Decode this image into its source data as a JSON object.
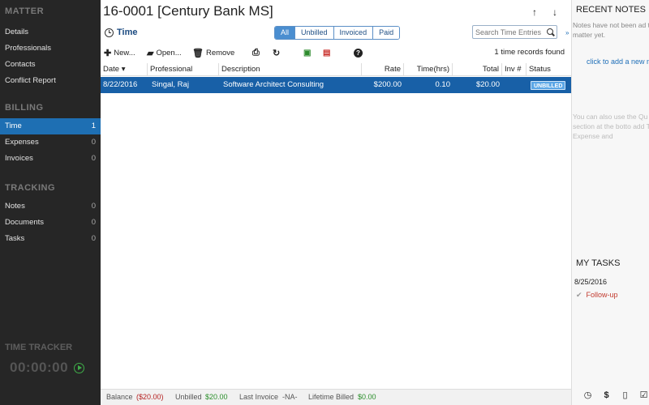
{
  "sidebar": {
    "sections": [
      {
        "title": "MATTER",
        "items": [
          {
            "label": "Details",
            "count": ""
          },
          {
            "label": "Professionals",
            "count": ""
          },
          {
            "label": "Contacts",
            "count": ""
          },
          {
            "label": "Conflict Report",
            "count": ""
          }
        ]
      },
      {
        "title": "BILLING",
        "items": [
          {
            "label": "Time",
            "count": "1"
          },
          {
            "label": "Expenses",
            "count": "0"
          },
          {
            "label": "Invoices",
            "count": "0"
          }
        ]
      },
      {
        "title": "TRACKING",
        "items": [
          {
            "label": "Notes",
            "count": "0"
          },
          {
            "label": "Documents",
            "count": "0"
          },
          {
            "label": "Tasks",
            "count": "0"
          }
        ]
      }
    ],
    "tracker_label": "TIME TRACKER",
    "tracker_time": "00:00:00"
  },
  "header": {
    "matter_title": "16-0001 [Century Bank MS]",
    "up_arrow": "↑",
    "down_arrow": "↓"
  },
  "time_view": {
    "label": "Time",
    "filters": [
      "All",
      "Unbilled",
      "Invoiced",
      "Paid"
    ],
    "active_filter": "All",
    "search_placeholder": "Search Time Entries"
  },
  "toolbar": {
    "new_label": "New...",
    "open_label": "Open...",
    "remove_label": "Remove",
    "records_found": "1 time records found"
  },
  "table": {
    "columns": [
      "Date",
      "Professional",
      "Description",
      "Rate",
      "Time(hrs)",
      "Total",
      "Inv #",
      "Status"
    ],
    "rows": [
      {
        "date": "8/22/2016",
        "professional": "Singal, Raj",
        "description": "Software Architect Consulting",
        "rate": "$200.00",
        "time": "0.10",
        "total": "$20.00",
        "inv": "",
        "status": "UNBILLED"
      }
    ]
  },
  "footer": {
    "balance_label": "Balance",
    "balance_value": "($20.00)",
    "unbilled_label": "Unbilled",
    "unbilled_value": "$20.00",
    "last_invoice_label": "Last Invoice",
    "last_invoice_value": "-NA-",
    "lifetime_label": "Lifetime Billed",
    "lifetime_value": "$0.00"
  },
  "right_panel": {
    "notes_title": "RECENT NOTES",
    "notes_empty": "Notes have not been ad this matter yet.",
    "add_link": "click to add a new n",
    "hint": "You can also use the Qu Add section at the botto add Time, Expense and",
    "tasks_title": "MY TASKS",
    "task_date": "8/25/2016",
    "task_item": "Follow-up"
  }
}
